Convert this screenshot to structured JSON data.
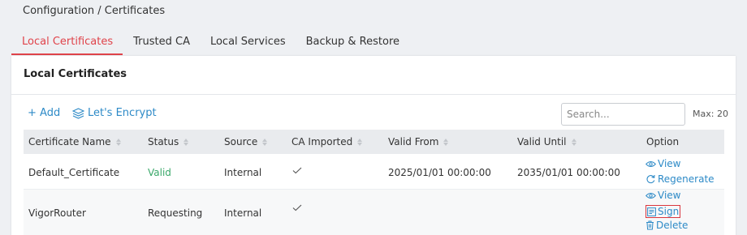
{
  "breadcrumb": "Configuration / Certificates",
  "tabs": [
    {
      "label": "Local Certificates",
      "active": true
    },
    {
      "label": "Trusted CA"
    },
    {
      "label": "Local Services"
    },
    {
      "label": "Backup & Restore"
    }
  ],
  "panel": {
    "title": "Local Certificates",
    "add_label": "+ Add",
    "lets_encrypt_label": "Let's Encrypt",
    "search_placeholder": "Search...",
    "max_label": "Max: 20"
  },
  "table": {
    "columns": [
      "Certificate Name",
      "Status",
      "Source",
      "CA Imported",
      "Valid From",
      "Valid Until",
      "Option"
    ],
    "rows": [
      {
        "name": "Default_Certificate",
        "status": "Valid",
        "source": "Internal",
        "ca_imported": true,
        "valid_from": "2025/01/01 00:00:00",
        "valid_until": "2035/01/01 00:00:00",
        "options": [
          "View",
          "Regenerate"
        ]
      },
      {
        "name": "VigorRouter",
        "status": "Requesting",
        "source": "Internal",
        "ca_imported": true,
        "valid_from": "",
        "valid_until": "",
        "options": [
          "View",
          "Sign",
          "Delete"
        ]
      }
    ]
  },
  "colors": {
    "accent_red": "#e0434a",
    "link_blue": "#2d8ac7",
    "valid_green": "#3aa86a"
  },
  "icons": {
    "lets_encrypt": "layers-icon",
    "view": "eye-icon",
    "regenerate": "refresh-icon",
    "sign": "sign-document-icon",
    "delete": "trash-icon",
    "sort": "sort-icon",
    "ca_imported": "check-icon"
  }
}
